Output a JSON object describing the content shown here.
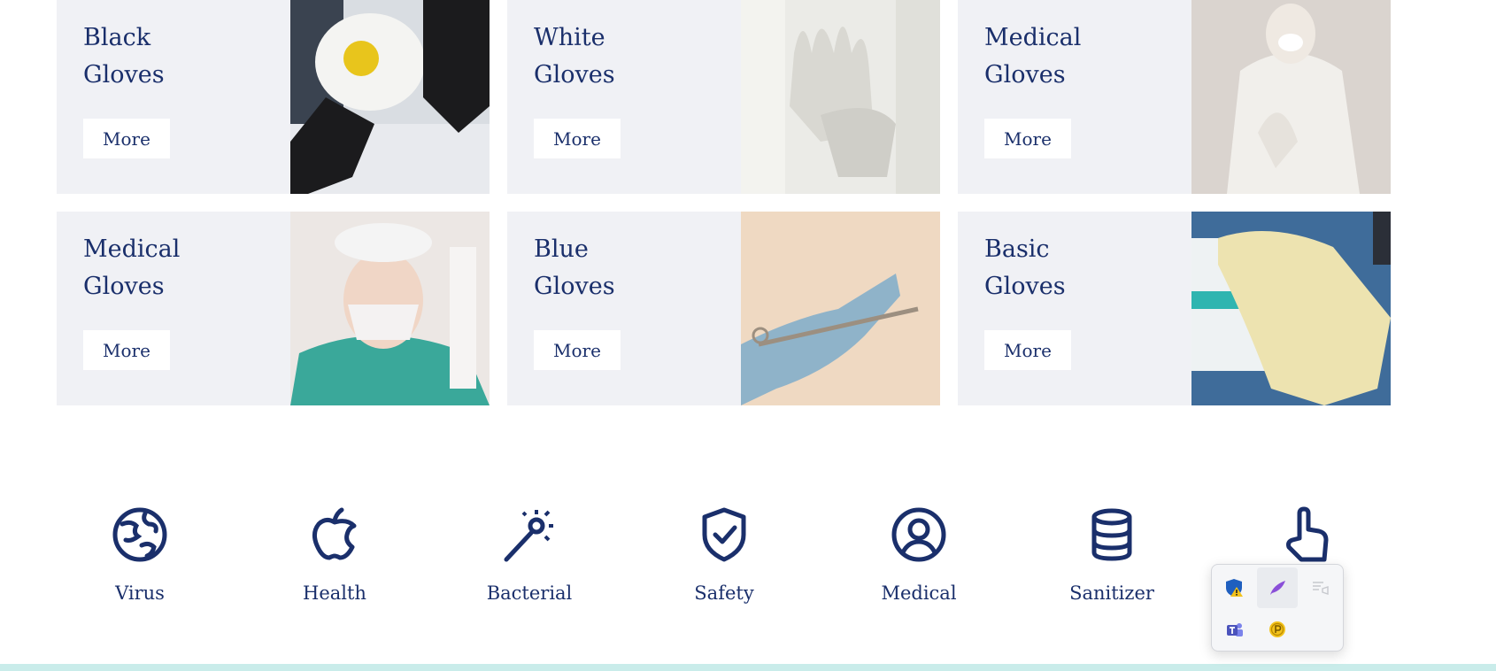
{
  "cards": [
    {
      "title": "Black\nGloves",
      "button": "More",
      "image": "black-gloves-respirator-photo"
    },
    {
      "title": "White\nGloves",
      "button": "More",
      "image": "white-gloves-photo"
    },
    {
      "title": "Medical\nGloves",
      "button": "More",
      "image": "protective-suit-gloves-photo"
    },
    {
      "title": "Medical\nGloves",
      "button": "More",
      "image": "surgeon-mask-photo"
    },
    {
      "title": "Blue\nGloves",
      "button": "More",
      "image": "blue-glove-scissors-photo"
    },
    {
      "title": "Basic\nGloves",
      "button": "More",
      "image": "latex-gloves-box-photo"
    }
  ],
  "features": [
    {
      "label": "Virus",
      "icon": "globe-icon"
    },
    {
      "label": "Health",
      "icon": "apple-icon"
    },
    {
      "label": "Bacterial",
      "icon": "magic-wand-icon"
    },
    {
      "label": "Safety",
      "icon": "shield-check-icon"
    },
    {
      "label": "Medical",
      "icon": "user-circle-icon"
    },
    {
      "label": "Sanitizer",
      "icon": "database-icon"
    },
    {
      "label": "",
      "icon": "pointer-hand-icon"
    }
  ],
  "tray": {
    "icons": [
      "defender-warning-icon",
      "feather-app-icon",
      "notification-icon",
      "teams-icon",
      "coin-p-icon"
    ]
  },
  "colors": {
    "brand": "#1a2f6b",
    "card_bg": "#f0f1f5",
    "strip": "#c9ecea"
  }
}
